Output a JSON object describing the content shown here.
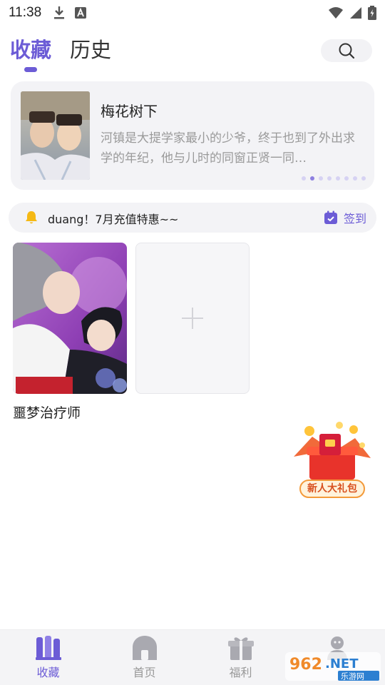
{
  "status_bar": {
    "time": "11:38"
  },
  "tabs": [
    {
      "label": "收藏",
      "active": true
    },
    {
      "label": "历史",
      "active": false
    }
  ],
  "featured": {
    "title": "梅花树下",
    "description": "河镇是大提学家最小的少爷，终于也到了外出求学的年纪，他与儿时的同窗正贤一同…",
    "dots_total": 8,
    "dots_active_index": 1
  },
  "notice": {
    "text": "duang！7月充值特惠~~",
    "checkin_label": "签到"
  },
  "shelf": {
    "items": [
      {
        "title": "噩梦治疗师"
      }
    ],
    "add_icon": "plus-icon"
  },
  "gift": {
    "label": "新人大礼包"
  },
  "bottom_nav": [
    {
      "label": "收藏",
      "icon": "books-icon",
      "active": true
    },
    {
      "label": "首页",
      "icon": "home-icon",
      "active": false
    },
    {
      "label": "福利",
      "icon": "gift-icon",
      "active": false
    },
    {
      "label": "",
      "icon": "user-icon",
      "active": false
    }
  ],
  "watermark": {
    "text": "962.NET",
    "subtext": "乐游网"
  },
  "colors": {
    "accent": "#6c5cd6",
    "card_bg": "#f3f3f6",
    "bell": "#f5b915"
  }
}
